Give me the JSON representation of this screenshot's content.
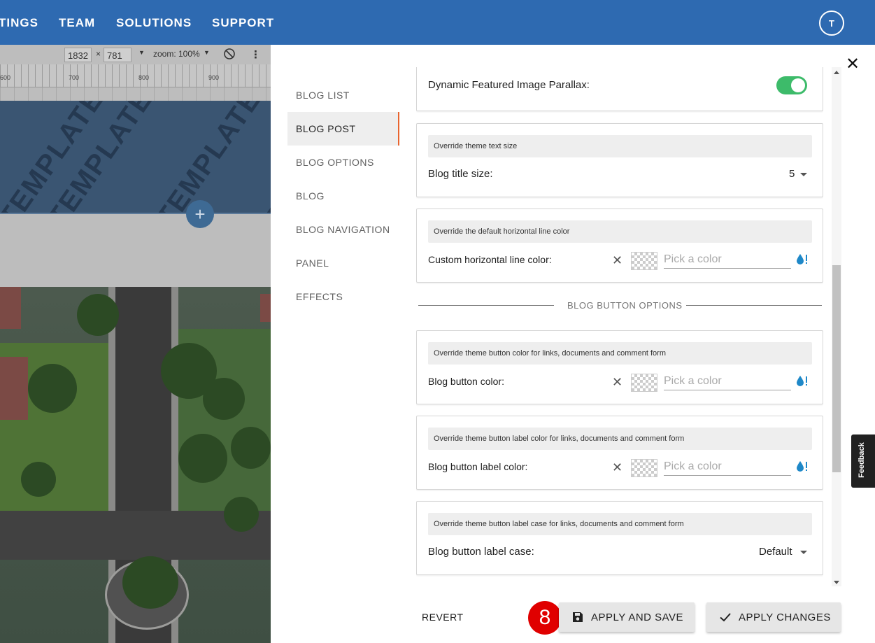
{
  "topnav": {
    "items": [
      "TINGS",
      "TEAM",
      "SOLUTIONS",
      "SUPPORT"
    ],
    "avatar_initial": "T"
  },
  "preview": {
    "toolbar": {
      "width": "1832",
      "times": "×",
      "height": "781",
      "zoom": "zoom: 100%"
    },
    "ruler_labels": [
      "600",
      "700",
      "800",
      "900"
    ],
    "watermark": "TEMPLATE",
    "add_symbol": "+"
  },
  "panel": {
    "close_symbol": "✕",
    "tabs": [
      "BLOG LIST",
      "BLOG POST",
      "BLOG OPTIONS",
      "BLOG",
      "BLOG NAVIGATION",
      "PANEL",
      "EFFECTS"
    ],
    "active_tab": "BLOG POST",
    "parallax": {
      "label": "Dynamic Featured Image Parallax:",
      "enabled": true
    },
    "title_size": {
      "hint": "Override theme text size",
      "label": "Blog title size:",
      "value": "5"
    },
    "hr_color": {
      "hint": "Override the default horizontal line color",
      "label": "Custom horizontal line color:",
      "placeholder": "Pick a color",
      "value": ""
    },
    "divider_label": "BLOG BUTTON OPTIONS",
    "button_color": {
      "hint": "Override theme button color for links, documents and comment form",
      "label": "Blog button color:",
      "placeholder": "Pick a color",
      "value": ""
    },
    "button_label_color": {
      "hint": "Override theme button label color for links, documents and comment form",
      "label": "Blog button label color:",
      "placeholder": "Pick a color",
      "value": ""
    },
    "button_label_case": {
      "hint": "Override theme button label case for links, documents and comment form",
      "label": "Blog button label case:",
      "value": "Default"
    },
    "clear_symbol": "✕",
    "footer": {
      "revert": "REVERT",
      "badge": "8",
      "apply_save": "APPLY AND SAVE",
      "apply_changes": "APPLY CHANGES"
    }
  },
  "feedback_label": "Feedback",
  "colors": {
    "nav_bg": "#2e6ab1",
    "toggle_on": "#3dbb6a",
    "active_tab_accent": "#e8642e",
    "drop_icon": "#1e88c8",
    "badge": "#e00000"
  }
}
